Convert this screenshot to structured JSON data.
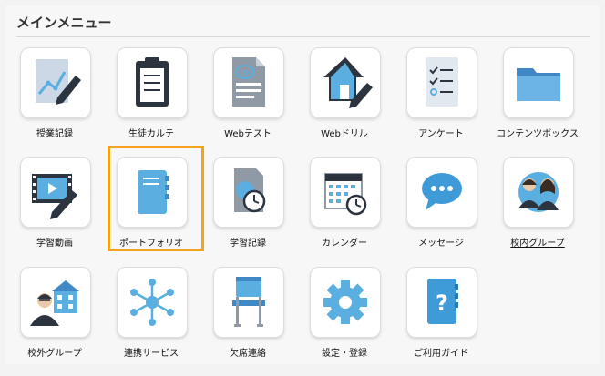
{
  "menu": {
    "title": "メインメニュー",
    "items": [
      {
        "label": "授業記録",
        "icon": "pen-chart-icon"
      },
      {
        "label": "生徒カルテ",
        "icon": "clipboard-icon"
      },
      {
        "label": "Webテスト",
        "icon": "test-sheet-icon"
      },
      {
        "label": "Webドリル",
        "icon": "house-pen-icon"
      },
      {
        "label": "アンケート",
        "icon": "checklist-icon"
      },
      {
        "label": "コンテンツボックス",
        "icon": "folder-icon"
      },
      {
        "label": "学習動画",
        "icon": "video-pen-icon"
      },
      {
        "label": "ポートフォリオ",
        "icon": "notebook-icon"
      },
      {
        "label": "学習記録",
        "icon": "clock-document-icon"
      },
      {
        "label": "カレンダー",
        "icon": "calendar-icon"
      },
      {
        "label": "メッセージ",
        "icon": "chat-bubble-icon"
      },
      {
        "label": "校内グループ",
        "icon": "group-people-icon"
      },
      {
        "label": "校外グループ",
        "icon": "school-person-icon"
      },
      {
        "label": "連携サービス",
        "icon": "network-icon"
      },
      {
        "label": "欠席連絡",
        "icon": "chair-icon"
      },
      {
        "label": "設定・登録",
        "icon": "gear-icon"
      },
      {
        "label": "ご利用ガイド",
        "icon": "help-book-icon"
      }
    ]
  },
  "colors": {
    "accent_blue": "#5aaee0",
    "dark": "#2c3440",
    "highlight": "#f0a31b"
  }
}
